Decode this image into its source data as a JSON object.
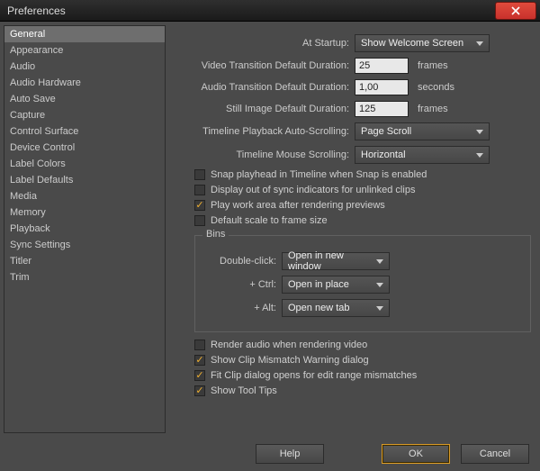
{
  "window": {
    "title": "Preferences"
  },
  "sidebar": {
    "items": [
      "General",
      "Appearance",
      "Audio",
      "Audio Hardware",
      "Auto Save",
      "Capture",
      "Control Surface",
      "Device Control",
      "Label Colors",
      "Label Defaults",
      "Media",
      "Memory",
      "Playback",
      "Sync Settings",
      "Titler",
      "Trim"
    ],
    "activeIndex": 0
  },
  "labels": {
    "atStartup": "At Startup:",
    "videoTransDur": "Video Transition Default Duration:",
    "audioTransDur": "Audio Transition Default Duration:",
    "stillDur": "Still Image Default Duration:",
    "timelineAuto": "Timeline Playback Auto-Scrolling:",
    "timelineMouse": "Timeline Mouse Scrolling:",
    "frames": "frames",
    "seconds": "seconds"
  },
  "values": {
    "atStartup": "Show Welcome Screen",
    "videoTransDur": "25",
    "audioTransDur": "1,00",
    "stillDur": "125",
    "timelineAuto": "Page Scroll",
    "timelineMouse": "Horizontal"
  },
  "checks": {
    "snapPlayhead": {
      "label": "Snap playhead in Timeline when Snap is enabled",
      "checked": false
    },
    "displayOOS": {
      "label": "Display out of sync indicators for unlinked clips",
      "checked": false
    },
    "playWorkArea": {
      "label": "Play work area after rendering previews",
      "checked": true
    },
    "defaultScale": {
      "label": "Default scale to frame size",
      "checked": false
    },
    "renderAudio": {
      "label": "Render audio when rendering video",
      "checked": false
    },
    "showMismatch": {
      "label": "Show Clip Mismatch Warning dialog",
      "checked": true
    },
    "fitClip": {
      "label": "Fit Clip dialog opens for edit range mismatches",
      "checked": true
    },
    "showTooltips": {
      "label": "Show Tool Tips",
      "checked": true
    }
  },
  "bins": {
    "title": "Bins",
    "rows": {
      "dblclick": {
        "label": "Double-click:",
        "value": "Open in new window"
      },
      "ctrl": {
        "label": "+ Ctrl:",
        "value": "Open in place"
      },
      "alt": {
        "label": "+ Alt:",
        "value": "Open new tab"
      }
    }
  },
  "footer": {
    "help": "Help",
    "ok": "OK",
    "cancel": "Cancel"
  }
}
